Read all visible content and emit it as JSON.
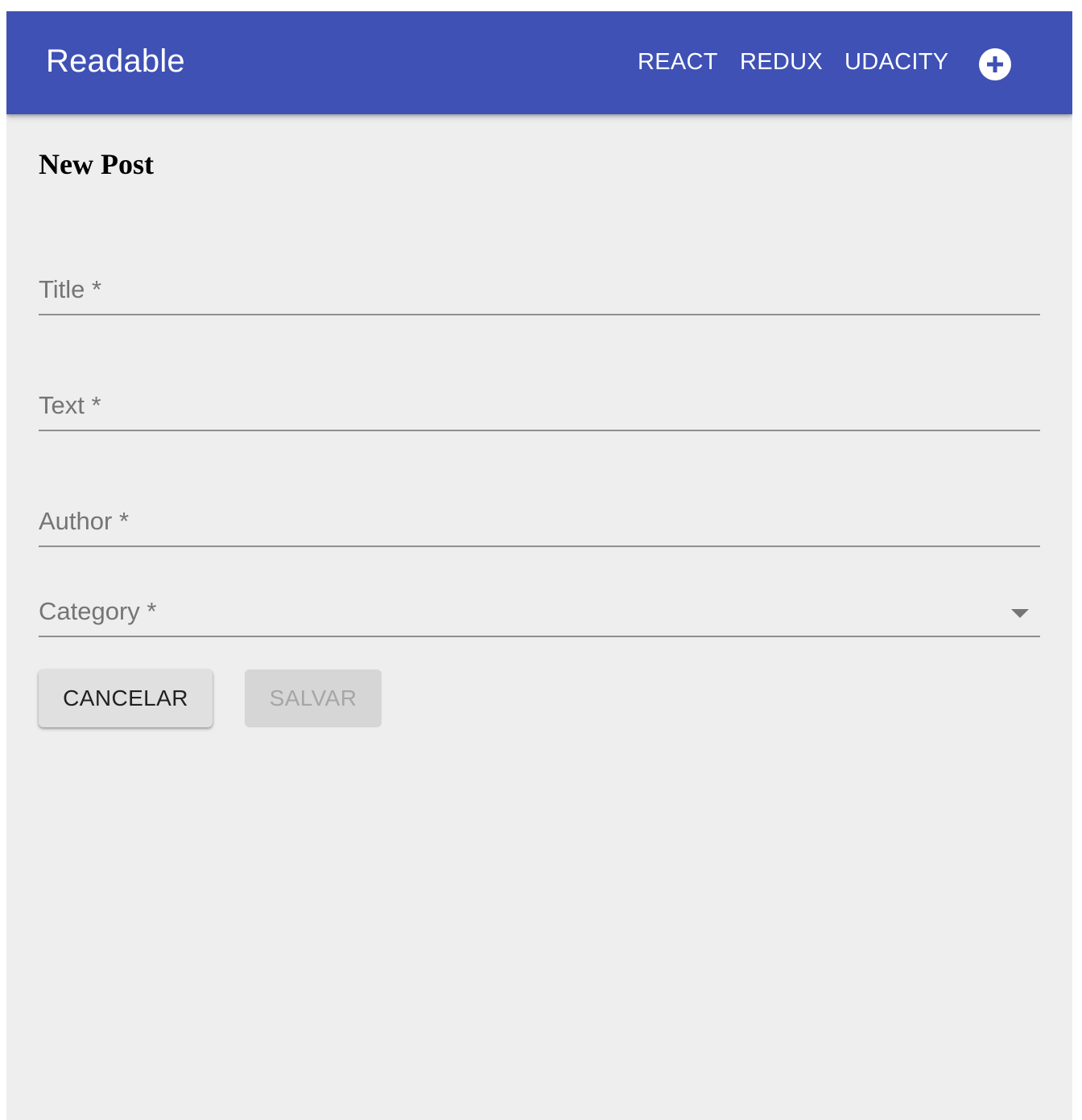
{
  "appbar": {
    "title": "Readable",
    "nav": [
      {
        "label": "REACT"
      },
      {
        "label": "REDUX"
      },
      {
        "label": "UDACITY"
      }
    ],
    "add_icon": "plus-circle-icon"
  },
  "page": {
    "heading": "New Post"
  },
  "form": {
    "title_label": "Title *",
    "text_label": "Text *",
    "author_label": "Author *",
    "category_label": "Category *",
    "category_icon": "chevron-down-icon",
    "cancel_label": "CANCELAR",
    "save_label": "SALVAR"
  },
  "colors": {
    "primary": "#3f51b5",
    "background": "#eeeeee",
    "disabled_text": "#a6a6a6"
  }
}
